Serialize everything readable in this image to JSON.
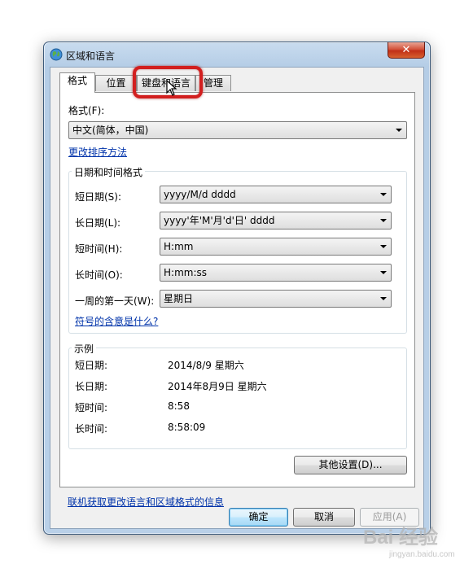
{
  "window": {
    "title": "区域和语言",
    "close_label": "✕"
  },
  "tabs": [
    {
      "label": "格式",
      "active": true
    },
    {
      "label": "位置",
      "active": false
    },
    {
      "label": "键盘和语言",
      "active": false
    },
    {
      "label": "管理",
      "active": false
    }
  ],
  "format": {
    "label": "格式(F):",
    "value": "中文(简体，中国)",
    "sort_link": "更改排序方法"
  },
  "datetime_group": {
    "title": "日期和时间格式",
    "rows": [
      {
        "label": "短日期(S):",
        "value": "yyyy/M/d dddd"
      },
      {
        "label": "长日期(L):",
        "value": "yyyy'年'M'月'd'日' dddd"
      },
      {
        "label": "短时间(H):",
        "value": "H:mm"
      },
      {
        "label": "长时间(O):",
        "value": "H:mm:ss"
      },
      {
        "label": "一周的第一天(W):",
        "value": "星期日"
      }
    ],
    "symbols_link": "符号的含意是什么?"
  },
  "example_group": {
    "title": "示例",
    "rows": [
      {
        "label": "短日期:",
        "value": "2014/8/9 星期六"
      },
      {
        "label": "长日期:",
        "value": "2014年8月9日 星期六"
      },
      {
        "label": "短时间:",
        "value": "8:58"
      },
      {
        "label": "长时间:",
        "value": "8:58:09"
      }
    ]
  },
  "other_settings_button": "其他设置(D)...",
  "online_link": "联机获取更改语言和区域格式的信息",
  "buttons": {
    "ok": "确定",
    "cancel": "取消",
    "apply": "应用(A)"
  },
  "watermark": {
    "text": "Bai 经验",
    "sub": "jingyan.baidu.com"
  },
  "colors": {
    "highlight": "#d21f1f",
    "link": "#0033aa"
  }
}
